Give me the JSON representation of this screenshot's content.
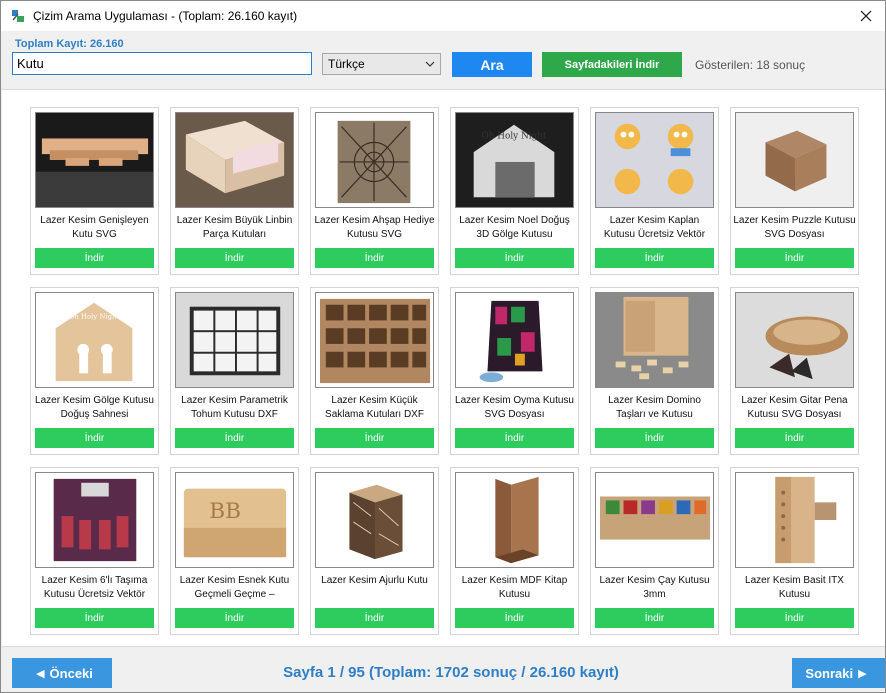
{
  "window": {
    "title": "Çizim Arama Uygulaması - (Toplam: 26.160 kayıt)",
    "close_icon": "close-icon",
    "app_icon": "app-icon"
  },
  "toolbar": {
    "total_label": "Toplam Kayıt: 26.160",
    "search_value": "Kutu",
    "language_selected": "Türkçe",
    "search_label": "Ara",
    "download_page_label": "Sayfadakileri İndir",
    "shown_label": "Gösterilen: 18 sonuç"
  },
  "colors": {
    "accent_blue": "#1e88f0",
    "label_blue": "#2f7fc6",
    "download_green": "#2ecc5e",
    "toolbar_green": "#2ea84a",
    "nav_blue": "#3a97df"
  },
  "cards": [
    {
      "title": "Lazer Kesim Genişleyen Kutu SVG",
      "download": "İndir"
    },
    {
      "title": "Lazer Kesim Büyük Linbin Parça Kutuları",
      "download": "İndir"
    },
    {
      "title": "Lazer Kesim Ahşap Hediye Kutusu SVG",
      "download": "İndir"
    },
    {
      "title": "Lazer Kesim Noel Doğuş 3D Gölge Kutusu",
      "download": "İndir"
    },
    {
      "title": "Lazer Kesim Kaplan Kutusu Ücretsiz Vektör",
      "download": "İndir"
    },
    {
      "title": "Lazer Kesim Puzzle Kutusu SVG Dosyası",
      "download": "İndir"
    },
    {
      "title": "Lazer Kesim Gölge Kutusu Doğuş Sahnesi",
      "download": "İndir"
    },
    {
      "title": "Lazer Kesim Parametrik Tohum Kutusu DXF",
      "download": "İndir"
    },
    {
      "title": "Lazer Kesim Küçük Saklama Kutuları DXF",
      "download": "İndir"
    },
    {
      "title": "Lazer Kesim Oyma Kutusu SVG Dosyası",
      "download": "İndir"
    },
    {
      "title": "Lazer Kesim Domino Taşları ve Kutusu",
      "download": "İndir"
    },
    {
      "title": "Lazer Kesim Gitar Pena Kutusu SVG Dosyası",
      "download": "İndir"
    },
    {
      "title": "Lazer Kesim 6'lı Taşıma Kutusu Ücretsiz Vektör",
      "download": "İndir"
    },
    {
      "title": "Lazer Kesim Esnek Kutu Geçmeli Geçme –",
      "download": "İndir"
    },
    {
      "title": "Lazer Kesim Ajurlu Kutu",
      "download": "İndir"
    },
    {
      "title": "Lazer Kesim MDF Kitap Kutusu",
      "download": "İndir"
    },
    {
      "title": "Lazer Kesim Çay Kutusu 3mm",
      "download": "İndir"
    },
    {
      "title": "Lazer Kesim Basit ITX Kutusu",
      "download": "İndir"
    }
  ],
  "pagination": {
    "prev_label": "Önceki",
    "next_label": "Sonraki",
    "page_info": "Sayfa 1 / 95 (Toplam: 1702 sonuç / 26.160 kayıt)"
  }
}
